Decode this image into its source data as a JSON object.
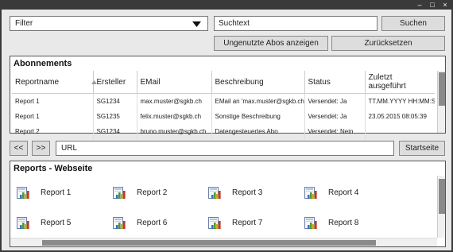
{
  "window": {
    "controls": [
      "–",
      "□",
      "×"
    ]
  },
  "toolbar": {
    "filter": {
      "value": "Filter"
    },
    "search": {
      "value": "Suchtext"
    },
    "search_button": "Suchen",
    "unused_button": "Ungenutzte Abos anzeigen",
    "reset_button": "Zurücksetzen"
  },
  "subscriptions": {
    "title": "Abonnements",
    "columns": [
      "Reportname",
      "Ersteller",
      "EMail",
      "Beschreibung",
      "Status",
      "Zuletzt ausgeführt"
    ],
    "rows": [
      [
        "Report 1",
        "SG1234",
        "max.muster@sgkb.ch",
        "EMail an 'max.muster@sgkb.ch'",
        "Versendet: Ja",
        "TT.MM.YYYY HH:MM:SS"
      ],
      [
        "Report 1",
        "SG1235",
        "felix.muster@sgkb.ch",
        "Sonstige Beschreibung",
        "Versendet: Ja",
        "23.05.2015 08:05:39"
      ],
      [
        "Report 2",
        "SG1234",
        "bruno.muster@sgkb.ch",
        "Datengesteuertes Abo",
        "Versendet: Nein",
        ""
      ]
    ]
  },
  "nav": {
    "back_label": "<<",
    "forward_label": ">>",
    "url": {
      "value": "URL"
    },
    "home_button": "Startseite"
  },
  "reports": {
    "title": "Reports - Webseite",
    "items": [
      "Report 1",
      "Report 2",
      "Report 3",
      "Report 4",
      "Report 5",
      "Report 6",
      "Report 7",
      "Report 8"
    ]
  },
  "colors": {
    "frame": "#3a3a3a",
    "scroll_thumb": "#8a8a8a",
    "button": "#dddddd"
  }
}
